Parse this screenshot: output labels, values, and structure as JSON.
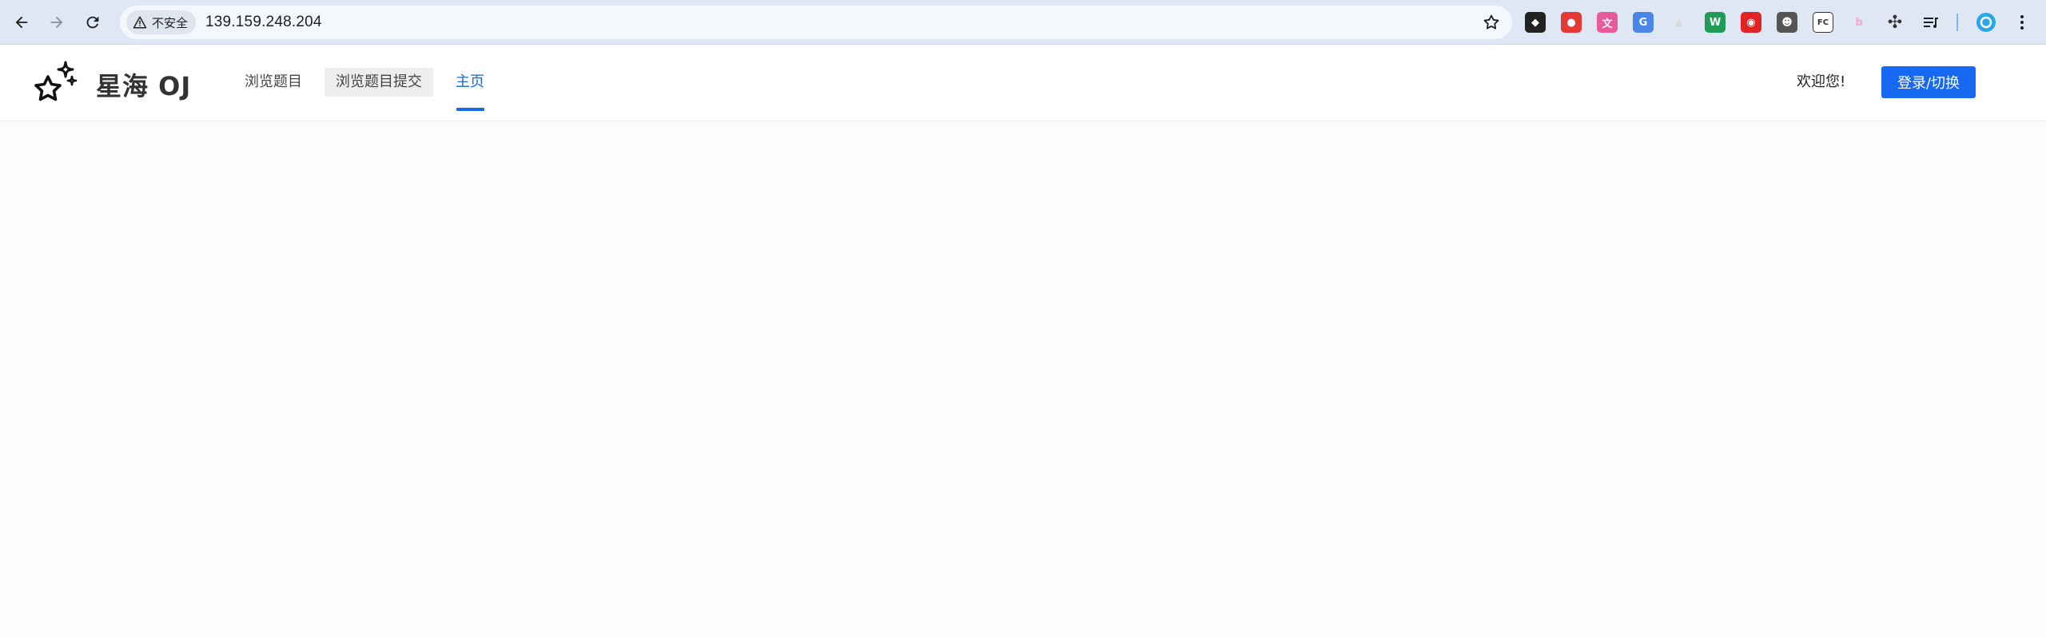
{
  "browser": {
    "security_label": "不安全",
    "url": "139.159.248.204",
    "extensions": [
      {
        "icon": "extension-ninja-icon",
        "color": "#222222",
        "glyph": "◆"
      },
      {
        "icon": "extension-red-face-icon",
        "color": "#e53935",
        "glyph": "●"
      },
      {
        "icon": "extension-translate-pink-icon",
        "color": "#e85a9c",
        "glyph": "文"
      },
      {
        "icon": "extension-google-translate-icon",
        "color": "#4a86e8",
        "glyph": "G"
      },
      {
        "icon": "extension-triangle-icon",
        "color": "#d9d9d9",
        "glyph": "▲"
      },
      {
        "icon": "extension-w-icon",
        "color": "#1f9d55",
        "glyph": "W"
      },
      {
        "icon": "extension-red-drop-icon",
        "color": "#e02424",
        "glyph": "◉"
      },
      {
        "icon": "extension-spy-icon",
        "color": "#555555",
        "glyph": "☻"
      },
      {
        "icon": "extension-fc-icon",
        "color": "#444444",
        "glyph": "FC"
      },
      {
        "icon": "extension-bing-icon",
        "color": "#f3a6d3",
        "glyph": "b"
      },
      {
        "icon": "extensions-puzzle-icon",
        "color": "#333333",
        "glyph": "✣"
      }
    ],
    "colors": {
      "chrome_bg": "#dfe6f4",
      "omnibox_bg": "#f4f7fb"
    }
  },
  "header": {
    "brand": "星海 OJ",
    "menu": [
      {
        "label": "浏览题目"
      },
      {
        "label": "浏览题目提交"
      },
      {
        "label": "主页"
      }
    ],
    "active_menu": "主页",
    "welcome": "欢迎您!",
    "login_button": "登录/切换",
    "colors": {
      "accent": "#1768f3",
      "active_text": "#1867d4"
    }
  }
}
